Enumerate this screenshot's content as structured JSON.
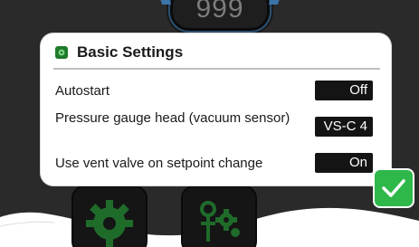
{
  "counter": {
    "value": "999"
  },
  "dialog": {
    "title": "Basic Settings",
    "icon": "gear-icon",
    "rows": [
      {
        "label": "Autostart",
        "value": "Off"
      },
      {
        "label": "Pressure gauge head (vacuum sensor)",
        "value": "VS-C 4"
      },
      {
        "label": "Use vent valve on setpoint change",
        "value": "On"
      }
    ]
  },
  "actions": {
    "confirm_icon": "checkmark-icon",
    "tiles": [
      {
        "icon": "gear-icon"
      },
      {
        "icon": "valve-settings-icon"
      }
    ]
  },
  "colors": {
    "accent_green": "#2fb84a",
    "dark_green_icon": "#1f7a2b",
    "background_dark": "#2a2a2a",
    "value_box": "#141414"
  }
}
